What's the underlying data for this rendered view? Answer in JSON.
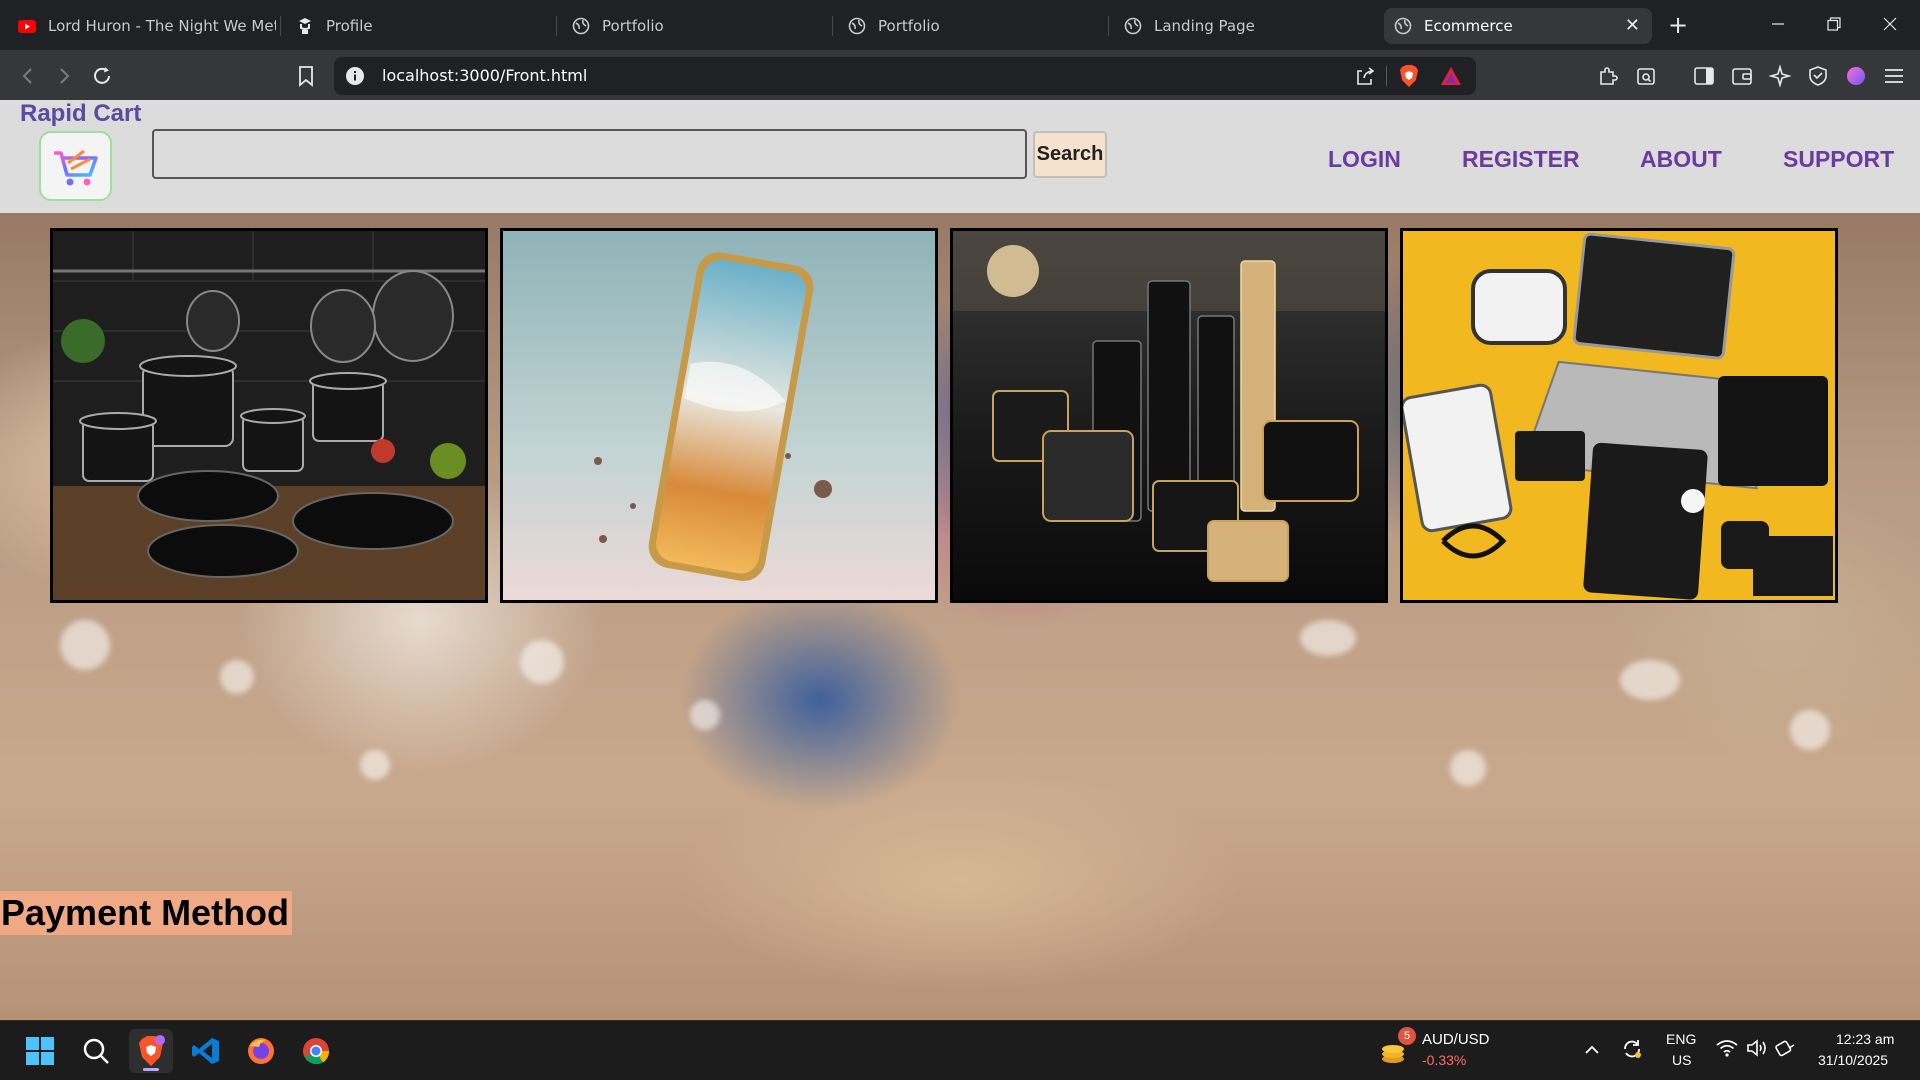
{
  "browser": {
    "tabs": [
      {
        "title": "Lord Huron - The Night We Met",
        "icon": "youtube-icon",
        "active": false
      },
      {
        "title": "Profile",
        "icon": "profile-icon",
        "active": false
      },
      {
        "title": "Portfolio",
        "icon": "globe-icon",
        "active": false
      },
      {
        "title": "Portfolio",
        "icon": "globe-icon",
        "active": false
      },
      {
        "title": "Landing Page",
        "icon": "globe-icon",
        "active": false
      },
      {
        "title": "Ecommerce",
        "icon": "globe-icon",
        "active": true
      }
    ],
    "url": "localhost:3000/Front.html"
  },
  "site": {
    "brand": "Rapid Cart",
    "search": {
      "value": "",
      "placeholder": "",
      "button_label": "Search"
    },
    "nav": [
      "LOGIN",
      "REGISTER",
      "ABOUT",
      "SUPPORT"
    ],
    "products": [
      {
        "name": "cookware"
      },
      {
        "name": "smartphone"
      },
      {
        "name": "cosmetics"
      },
      {
        "name": "electronics"
      }
    ],
    "payment_heading": "Payment Method"
  },
  "taskbar": {
    "apps": [
      "start-icon",
      "search-icon",
      "brave-icon",
      "vscode-icon",
      "firefox-icon",
      "chrome-icon"
    ],
    "widget": {
      "badge": "5",
      "label": "AUD/USD",
      "change": "-0.33%"
    },
    "language": {
      "lang": "ENG",
      "region": "US"
    },
    "clock": {
      "time": "12:23 am",
      "date": "31/10/2025"
    }
  },
  "colors": {
    "nav_link": "#6a3aa0",
    "brand": "#5a4aa0",
    "payment_bg": "#f0a985",
    "search_button_bg": "#f6e1cc"
  }
}
